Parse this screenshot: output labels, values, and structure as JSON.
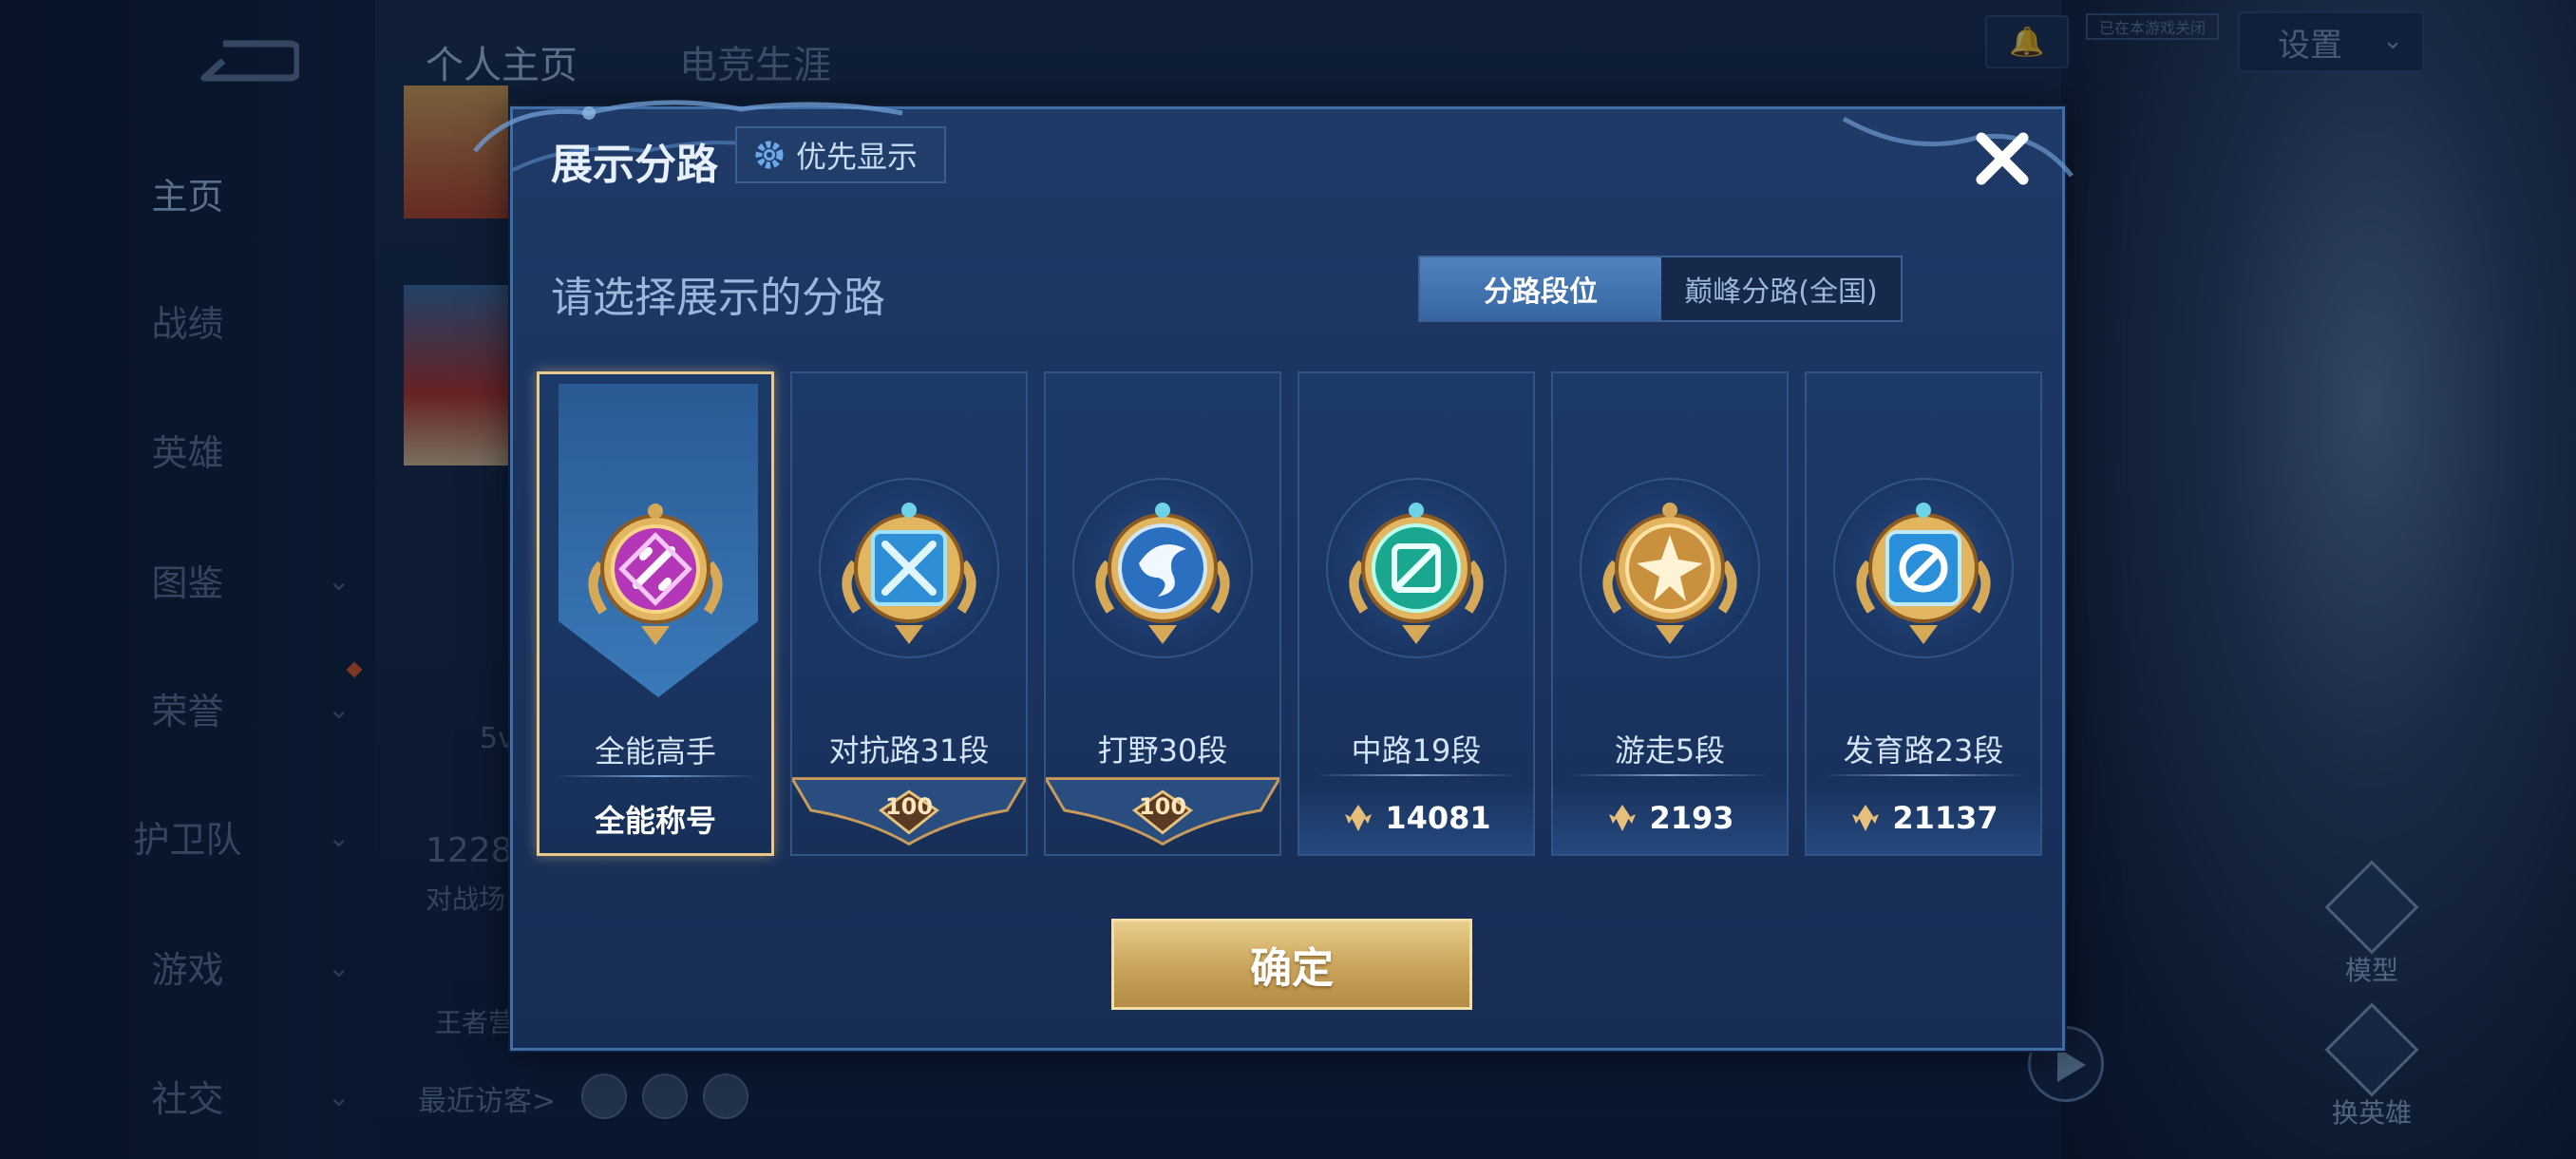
{
  "sidebar": {
    "items": [
      {
        "label": "主页",
        "active": true,
        "has_chevron": false
      },
      {
        "label": "战绩",
        "active": false,
        "has_chevron": false
      },
      {
        "label": "英雄",
        "active": false,
        "has_chevron": false
      },
      {
        "label": "图鉴",
        "active": false,
        "has_chevron": true
      },
      {
        "label": "荣誉",
        "active": false,
        "has_chevron": true
      },
      {
        "label": "护卫队",
        "active": false,
        "has_chevron": true
      },
      {
        "label": "游戏",
        "active": false,
        "has_chevron": true
      },
      {
        "label": "社交",
        "active": false,
        "has_chevron": true
      }
    ]
  },
  "header": {
    "tabs": [
      "个人主页",
      "电竞生涯"
    ],
    "hide_tag": "已在本游戏关闭",
    "settings_label": "设置"
  },
  "background": {
    "stat_value": "1228",
    "stat_label": "对战场",
    "peek_5v": "5v",
    "peek_wzr": "王者营",
    "recent_visitors_label": "最近访客>",
    "side_buttons": [
      "模型",
      "换英雄"
    ]
  },
  "modal": {
    "title": "展示分路",
    "priority_label": "优先显示",
    "subtitle": "请选择展示的分路",
    "tabs": [
      {
        "label": "分路段位",
        "active": true
      },
      {
        "label": "巅峰分路(全国)",
        "active": false
      }
    ],
    "lanes": [
      {
        "name": "全能高手",
        "footer": "全能称号",
        "footer_type": "text",
        "selected": true,
        "emblem_color": "#b437b8"
      },
      {
        "name": "对抗路31段",
        "footer": "100",
        "footer_type": "badge",
        "selected": false,
        "emblem_color": "#2e8fd6"
      },
      {
        "name": "打野30段",
        "footer": "100",
        "footer_type": "badge",
        "selected": false,
        "emblem_color": "#2a6fc0"
      },
      {
        "name": "中路19段",
        "footer": "14081",
        "footer_type": "score",
        "selected": false,
        "emblem_color": "#19a88f"
      },
      {
        "name": "游走5段",
        "footer": "2193",
        "footer_type": "score",
        "selected": false,
        "emblem_color": "#c9913e"
      },
      {
        "name": "发育路23段",
        "footer": "21137",
        "footer_type": "score",
        "selected": false,
        "emblem_color": "#2b8fd9"
      }
    ],
    "confirm_label": "确定"
  },
  "colors": {
    "accent_gold": "#e8c98a",
    "panel_blue": "#1f3a66",
    "tab_active": "#4f82bf"
  }
}
